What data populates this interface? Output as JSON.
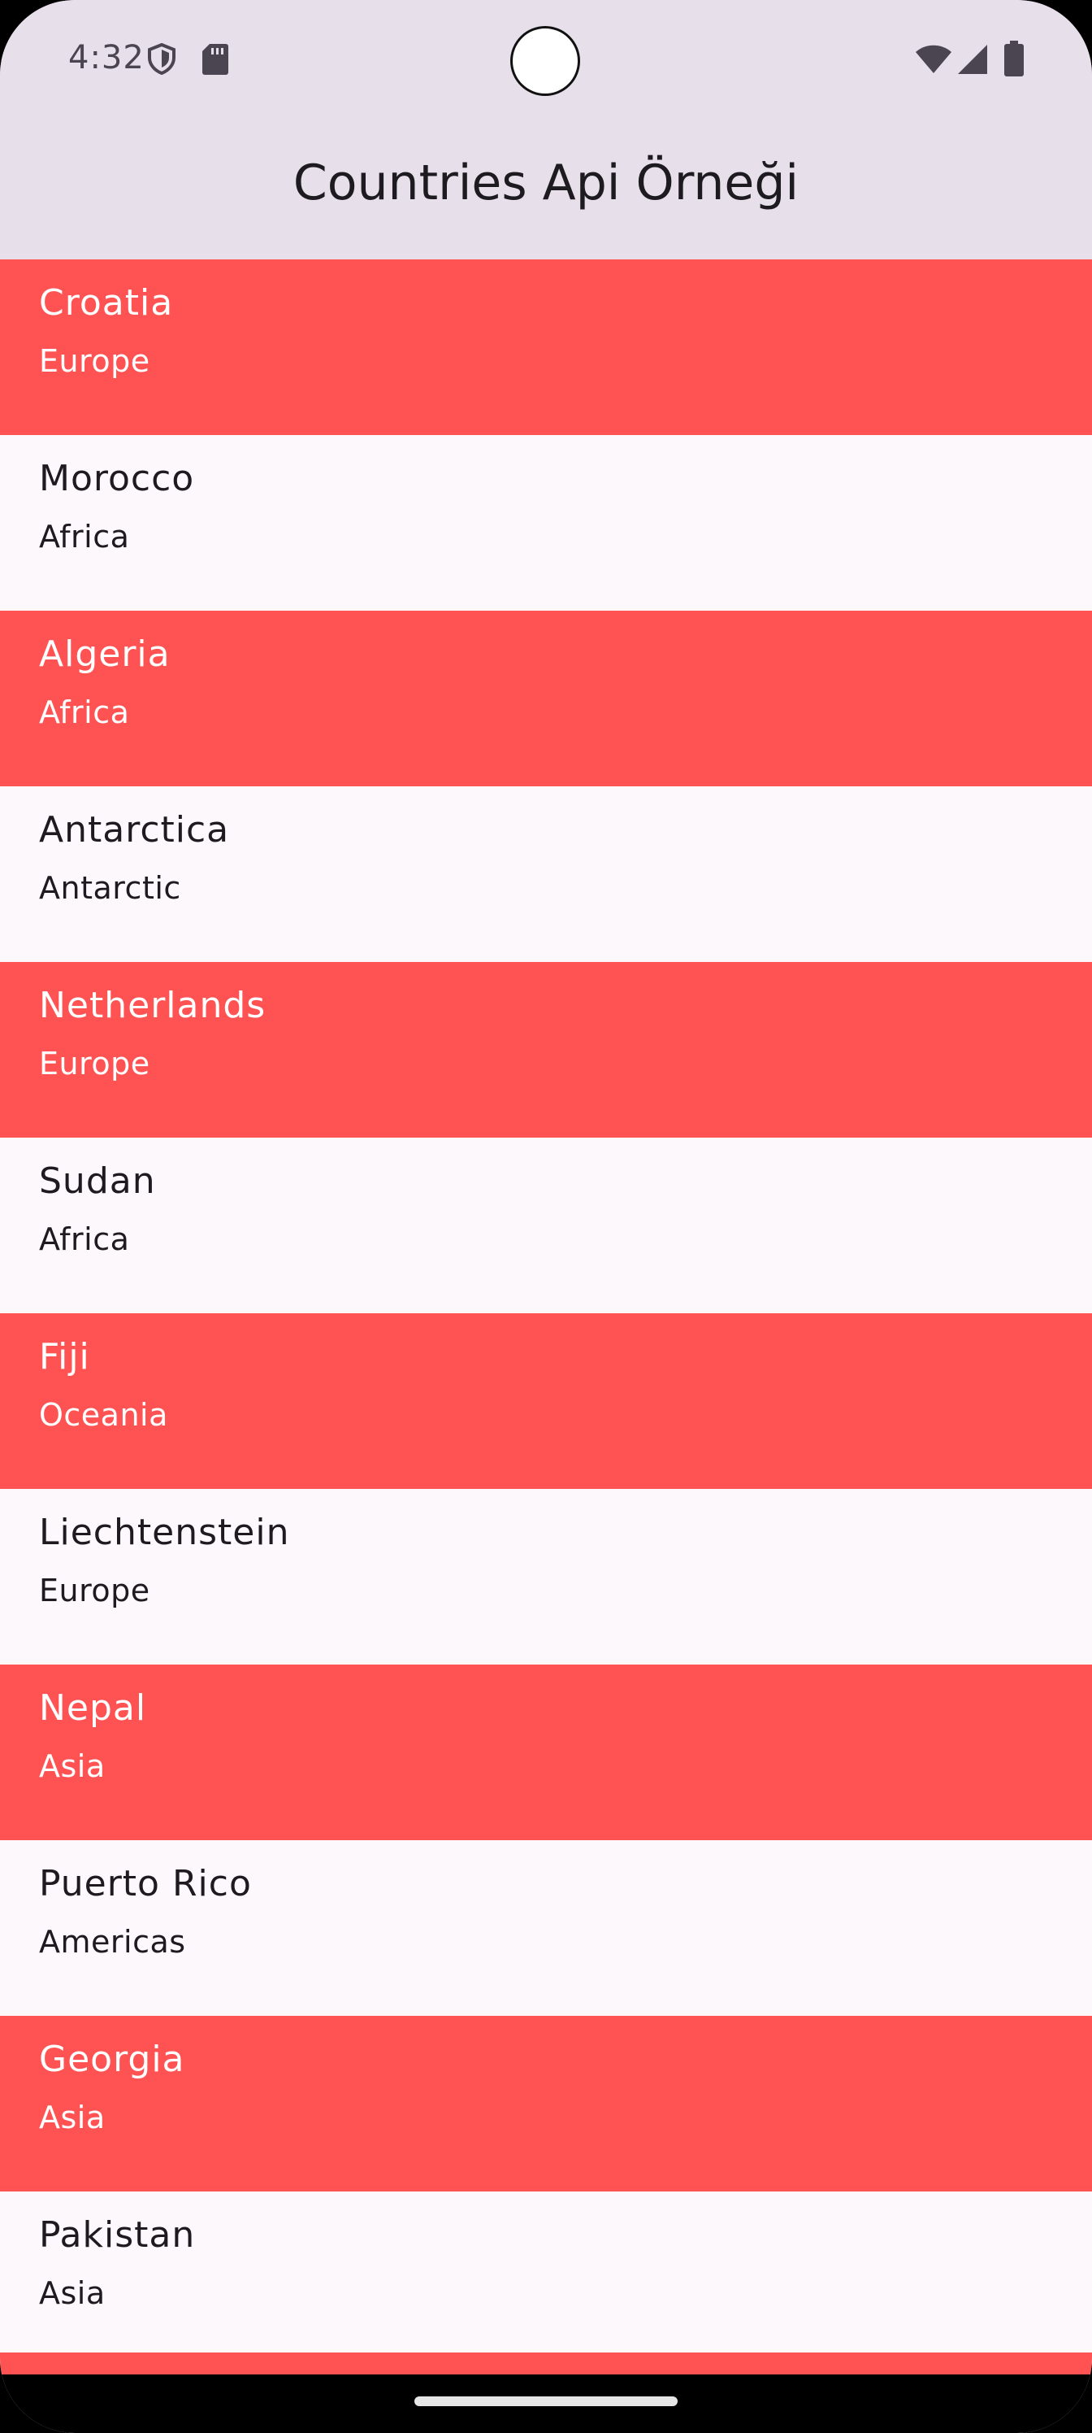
{
  "status_bar": {
    "time": "4:32",
    "icons": [
      "shield-icon",
      "sd-card-icon",
      "wifi-icon",
      "signal-icon",
      "battery-icon"
    ]
  },
  "app_bar": {
    "title": "Countries Api Örneği"
  },
  "colors": {
    "app_bar_bg": "#e7e0eb",
    "highlight_row": "#ff5353",
    "plain_row": "#fdf8fc"
  },
  "countries": [
    {
      "name": "Croatia",
      "region": "Europe"
    },
    {
      "name": "Morocco",
      "region": "Africa"
    },
    {
      "name": "Algeria",
      "region": "Africa"
    },
    {
      "name": "Antarctica",
      "region": "Antarctic"
    },
    {
      "name": "Netherlands",
      "region": "Europe"
    },
    {
      "name": "Sudan",
      "region": "Africa"
    },
    {
      "name": "Fiji",
      "region": "Oceania"
    },
    {
      "name": "Liechtenstein",
      "region": "Europe"
    },
    {
      "name": "Nepal",
      "region": "Asia"
    },
    {
      "name": "Puerto Rico",
      "region": "Americas"
    },
    {
      "name": "Georgia",
      "region": "Asia"
    },
    {
      "name": "Pakistan",
      "region": "Asia"
    }
  ]
}
